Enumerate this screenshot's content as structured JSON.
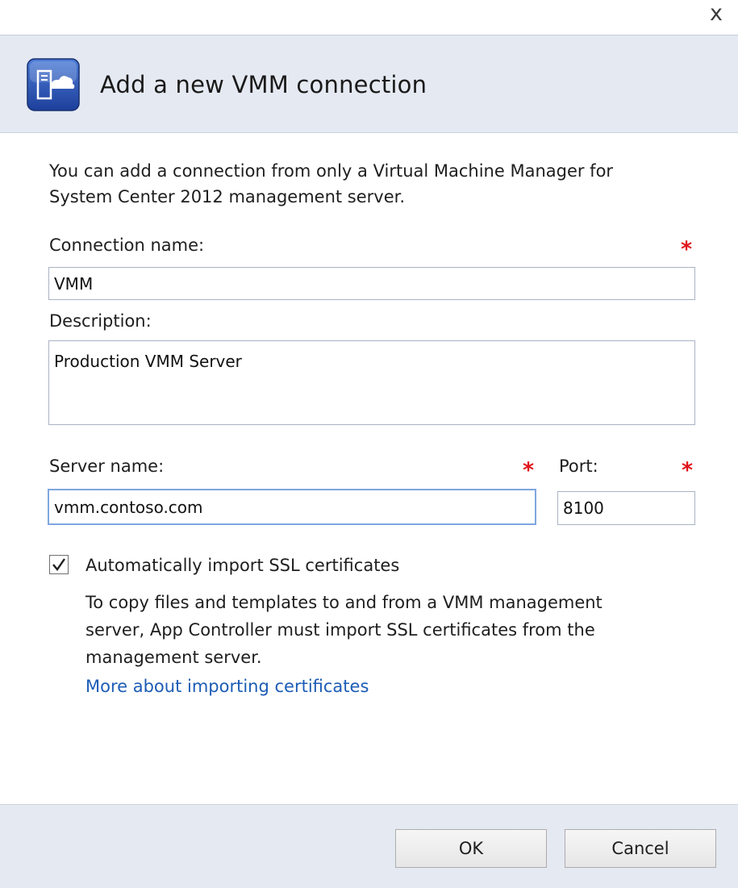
{
  "dialog": {
    "title": "Add a new VMM connection",
    "close_glyph": "x",
    "icon": "vmm-connection-icon"
  },
  "intro": "You can add a connection from only a Virtual Machine Manager for System Center 2012 management server.",
  "required_marker": "*",
  "connection_name": {
    "label": "Connection name:",
    "value": "VMM"
  },
  "description": {
    "label": "Description:",
    "value": "Production VMM Server"
  },
  "server_name": {
    "label": "Server name:",
    "value": "vmm.contoso.com"
  },
  "port": {
    "label": "Port:",
    "value": "8100"
  },
  "ssl": {
    "checked": true,
    "label": "Automatically import SSL certificates",
    "description": "To copy files and templates to and from a VMM management server, App Controller must import SSL certificates from the management server.",
    "link": "More about importing certificates"
  },
  "buttons": {
    "ok": "OK",
    "cancel": "Cancel"
  },
  "colors": {
    "header_bg": "#e5e9f2",
    "required": "#e0141a",
    "link": "#1c5cb5",
    "focus_border": "#7ea6e0"
  }
}
